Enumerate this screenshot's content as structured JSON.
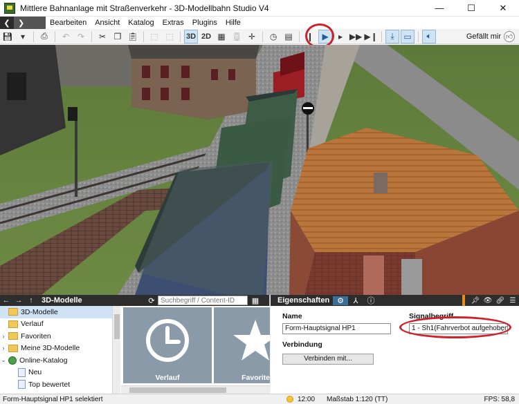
{
  "window": {
    "title": "Mittlere Bahnanlage mit Straßenverkehr - 3D-Modellbahn Studio V4",
    "minimize": "—",
    "maximize": "☐",
    "close": "✕"
  },
  "menu": {
    "back": "❮",
    "forward": "❯",
    "items": [
      "Bearbeiten",
      "Ansicht",
      "Katalog",
      "Extras",
      "Plugins",
      "Hilfe"
    ]
  },
  "toolbar": {
    "view_3d": "3D",
    "view_2d": "2D",
    "like_label": "Gefällt mir"
  },
  "models_panel": {
    "title": "3D-Modelle",
    "search_placeholder": "Suchbegriff / Content-ID",
    "tree": [
      {
        "label": "3D-Modelle",
        "expander": "",
        "icon": "folder",
        "selected": true
      },
      {
        "label": "Verlauf",
        "expander": "",
        "icon": "folder",
        "selected": false
      },
      {
        "label": "Favoriten",
        "expander": "›",
        "icon": "folder",
        "selected": false
      },
      {
        "label": "Meine 3D-Modelle",
        "expander": "›",
        "icon": "folder",
        "selected": false
      },
      {
        "label": "Online-Katalog",
        "expander": "⌄",
        "icon": "globe",
        "selected": false
      },
      {
        "label": "Neu",
        "expander": "",
        "icon": "doc",
        "selected": false
      },
      {
        "label": "Top bewertet",
        "expander": "",
        "icon": "doc",
        "selected": false
      }
    ],
    "tiles": [
      {
        "label": "Verlauf",
        "icon": "clock-icon"
      },
      {
        "label": "Favorite",
        "icon": "star-icon"
      }
    ]
  },
  "properties": {
    "title": "Eigenschaften",
    "name_label": "Name",
    "name_value": "Form-Hauptsignal HP1",
    "connection_label": "Verbindung",
    "connect_button": "Verbinden mit...",
    "signal_label": "Signalbegriff",
    "signal_value": "1 - Sh1(Fahrverbot aufgehoben"
  },
  "status": {
    "selection": "Form-Hauptsignal HP1 selektiert",
    "time": "12:00",
    "scale": "Maßstab 1:120 (TT)",
    "fps": "FPS: 58,8"
  },
  "colors": {
    "accent": "#3d6e96",
    "highlight": "#d0202a",
    "panel_header": "#2d2d2d"
  }
}
